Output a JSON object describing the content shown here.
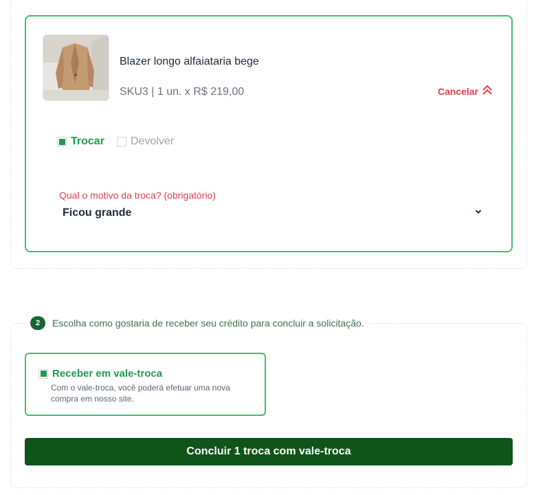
{
  "item": {
    "name": "Blazer longo alfaiataria bege",
    "meta": "SKU3 | 1 un. x R$ 219,00",
    "cancel_label": "Cancelar",
    "options": {
      "exchange": "Trocar",
      "return": "Devolver",
      "selected": "exchange"
    },
    "reason": {
      "label": "Qual o motivo da troca? (obrigatório)",
      "value": "Ficou grande"
    }
  },
  "step2": {
    "number": "2",
    "text": "Escolha como gostaria de receber seu crédito para concluir a solicitação.",
    "credit_option": {
      "title": "Receber em vale-troca",
      "description": "Com o vale-troca, você poderá efetuar uma nova compra em nosso site."
    }
  },
  "submit_label": "Concluir 1 troca com vale-troca",
  "colors": {
    "green": "#1f9a4d",
    "border_green": "#3cc16a",
    "red": "#e53e4d",
    "button": "#0f5418"
  }
}
